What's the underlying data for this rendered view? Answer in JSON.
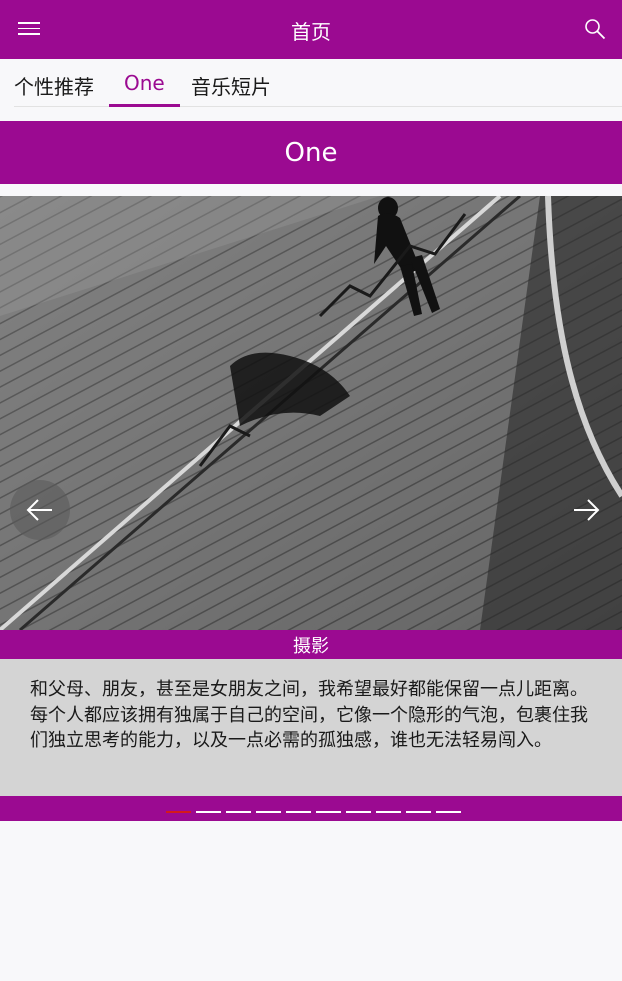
{
  "header": {
    "title": "首页",
    "menu_icon": "hamburger-menu-icon",
    "search_icon": "search-icon"
  },
  "tabs": [
    {
      "label": "个性推荐",
      "active": false
    },
    {
      "label": "One",
      "active": true
    },
    {
      "label": "音乐短片",
      "active": false
    }
  ],
  "section": {
    "title": "One"
  },
  "carousel": {
    "image_description": "black-and-white photo",
    "caption": "摄影",
    "quote": "和父母、朋友，甚至是女朋友之间，我希望最好都能保留一点儿距离。每个人都应该拥有独属于自己的空间，它像一个隐形的气泡，包裹住我们独立思考的能力，以及一点必需的孤独感，谁也无法轻易闯入。",
    "prev_icon": "arrow-left-icon",
    "next_icon": "arrow-right-icon",
    "slide_count": 10,
    "active_index": 0
  },
  "colors": {
    "accent": "#9b0a91",
    "active_dot": "#d41a1a",
    "quote_bg": "#d4d4d4",
    "page_bg": "#f8f8fa"
  }
}
